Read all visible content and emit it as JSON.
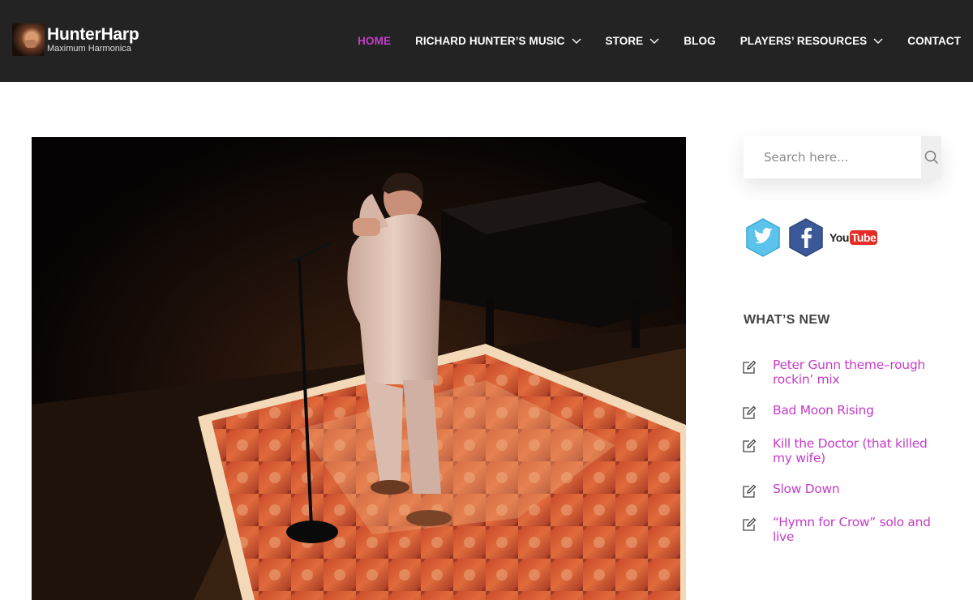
{
  "header": {
    "logo_title": "HunterHarp",
    "logo_subtitle": "Maximum Harmonica",
    "nav": [
      {
        "label": "HOME",
        "active": true,
        "dropdown": false
      },
      {
        "label": "RICHARD HUNTER’S MUSIC",
        "active": false,
        "dropdown": true
      },
      {
        "label": "STORE",
        "active": false,
        "dropdown": true
      },
      {
        "label": "BLOG",
        "active": false,
        "dropdown": false
      },
      {
        "label": "PLAYERS’ RESOURCES",
        "active": false,
        "dropdown": true
      },
      {
        "label": "CONTACT",
        "active": false,
        "dropdown": false
      }
    ]
  },
  "search": {
    "placeholder": "Search here...",
    "value": ""
  },
  "social": {
    "youtube_you": "You",
    "youtube_tube": "Tube"
  },
  "sidebar": {
    "widget_title": "WHAT’S NEW",
    "posts": [
      {
        "title": "Peter Gunn theme–rough rockin’ mix"
      },
      {
        "title": "Bad Moon Rising"
      },
      {
        "title": "Kill the Doctor (that killed my wife)"
      },
      {
        "title": "Slow Down"
      },
      {
        "title": "“Hymn for Crow” solo and live"
      }
    ]
  },
  "colors": {
    "header_bg": "#232323",
    "accent": "#c33dc7",
    "twitter": "#5bc3ec",
    "facebook": "#3b5998",
    "youtube_red": "#e52d27"
  }
}
